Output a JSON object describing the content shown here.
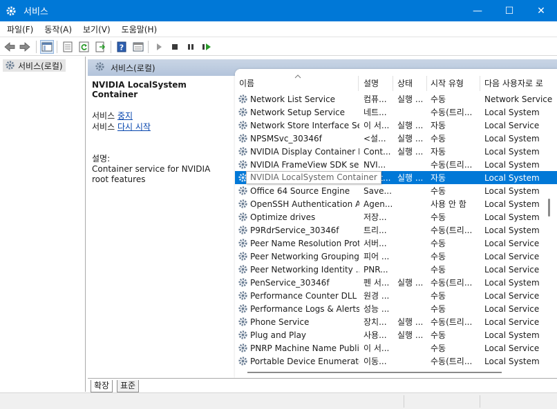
{
  "window": {
    "title": "서비스",
    "minimize": "—",
    "maximize": "☐",
    "close": "✕"
  },
  "menu": [
    {
      "label": "파일(F)"
    },
    {
      "label": "동작(A)"
    },
    {
      "label": "보기(V)"
    },
    {
      "label": "도움말(H)"
    }
  ],
  "tree": {
    "item": "서비스(로컬)"
  },
  "pane": {
    "header": "서비스(로컬)"
  },
  "details": {
    "title": "NVIDIA LocalSystem Container",
    "stop_prefix": "서비스 ",
    "stop_link": "중지",
    "restart_prefix": "서비스 ",
    "restart_link": "다시 시작",
    "desc_label": "설명:",
    "desc_text": "Container service for NVIDIA root features"
  },
  "columns": {
    "name": "이름",
    "description": "설명",
    "status": "상태",
    "startup": "시작 유형",
    "logon": "다음 사용자로 로"
  },
  "services": [
    {
      "name": "Network List Service",
      "desc": "컴퓨...",
      "status": "실행 ...",
      "startup": "수동",
      "logon": "Network Service"
    },
    {
      "name": "Network Setup Service",
      "desc": "네트...",
      "status": "",
      "startup": "수동(트리...",
      "logon": "Local System"
    },
    {
      "name": "Network Store Interface Se...",
      "desc": "이 서...",
      "status": "실행 ...",
      "startup": "자동",
      "logon": "Local Service"
    },
    {
      "name": "NPSMSvc_30346f",
      "desc": "<설...",
      "status": "실행 ...",
      "startup": "수동",
      "logon": "Local System"
    },
    {
      "name": "NVIDIA Display Container LS",
      "desc": "Cont...",
      "status": "실행 ...",
      "startup": "자동",
      "logon": "Local System"
    },
    {
      "name": "NVIDIA FrameView SDK se...",
      "desc": "NVI...",
      "status": "",
      "startup": "수동(트리...",
      "logon": "Local System"
    },
    {
      "name": "NVIDIA LocalSystem Container",
      "desc": "Cont...",
      "status": "실행 ...",
      "startup": "자동",
      "logon": "Local System",
      "selected": true
    },
    {
      "name": "Office 64 Source Engine",
      "desc": "Save...",
      "status": "",
      "startup": "수동",
      "logon": "Local System"
    },
    {
      "name": "OpenSSH Authentication A...",
      "desc": "Agen...",
      "status": "",
      "startup": "사용 안 함",
      "logon": "Local System"
    },
    {
      "name": "Optimize drives",
      "desc": "저장...",
      "status": "",
      "startup": "수동",
      "logon": "Local System"
    },
    {
      "name": "P9RdrService_30346f",
      "desc": "트리...",
      "status": "",
      "startup": "수동(트리...",
      "logon": "Local System"
    },
    {
      "name": "Peer Name Resolution Prot...",
      "desc": "서버...",
      "status": "",
      "startup": "수동",
      "logon": "Local Service"
    },
    {
      "name": "Peer Networking Grouping",
      "desc": "피어 ...",
      "status": "",
      "startup": "수동",
      "logon": "Local Service"
    },
    {
      "name": "Peer Networking Identity ...",
      "desc": "PNR...",
      "status": "",
      "startup": "수동",
      "logon": "Local Service"
    },
    {
      "name": "PenService_30346f",
      "desc": "펜 서...",
      "status": "실행 ...",
      "startup": "수동(트리...",
      "logon": "Local System"
    },
    {
      "name": "Performance Counter DLL ...",
      "desc": "원경 ...",
      "status": "",
      "startup": "수동",
      "logon": "Local Service"
    },
    {
      "name": "Performance Logs & Alerts",
      "desc": "성능 ...",
      "status": "",
      "startup": "수동",
      "logon": "Local Service"
    },
    {
      "name": "Phone Service",
      "desc": "장치...",
      "status": "실행 ...",
      "startup": "수동(트리...",
      "logon": "Local Service"
    },
    {
      "name": "Plug and Play",
      "desc": "사용...",
      "status": "실행 ...",
      "startup": "수동",
      "logon": "Local System"
    },
    {
      "name": "PNRP Machine Name Publi...",
      "desc": "이 서...",
      "status": "",
      "startup": "수동",
      "logon": "Local Service"
    },
    {
      "name": "Portable Device Enumerato...",
      "desc": "이동...",
      "status": "",
      "startup": "수동(트리...",
      "logon": "Local System"
    }
  ],
  "tabs": {
    "extended": "확장",
    "standard": "표준"
  },
  "colors": {
    "titlebar": "#0078d7",
    "selection": "#0078d7",
    "link": "#0645ad"
  }
}
